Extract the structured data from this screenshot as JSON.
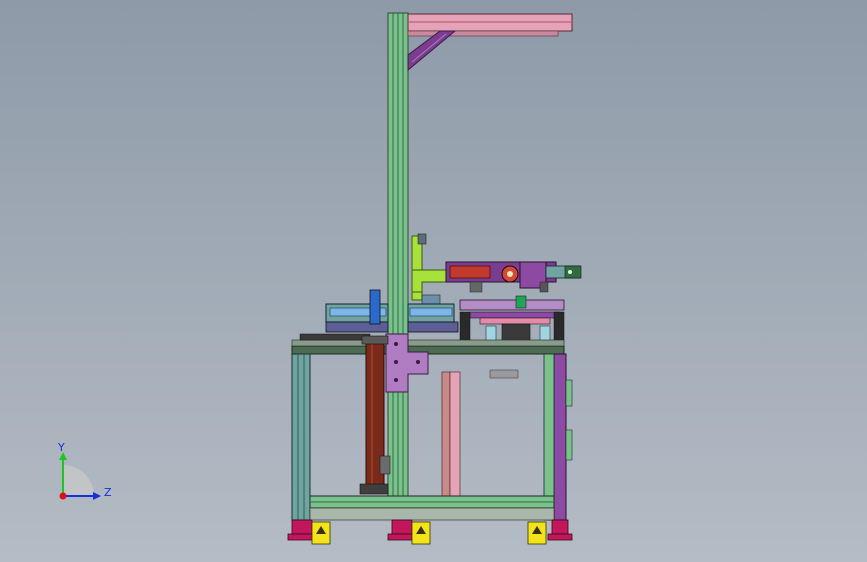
{
  "triad": {
    "y_label": "Y",
    "z_label": "Z",
    "colors": {
      "y": "#21c521",
      "z": "#1530e0",
      "x": "#e01010",
      "quadrant": "#c7c7c7"
    }
  },
  "model_colors": {
    "profile_green": "#7bc18d",
    "profile_green_dark": "#2f6d40",
    "pink_beam": "#e6a2b6",
    "purple": "#7a3d8f",
    "lime": "#a6e23a",
    "teal": "#6fa4a0",
    "magenta": "#c2185b",
    "yellow": "#f2e31a",
    "blue_plate": "#7ab6e8",
    "brown_cyl": "#7a2a1a",
    "gray_dark": "#3a3a3a"
  }
}
